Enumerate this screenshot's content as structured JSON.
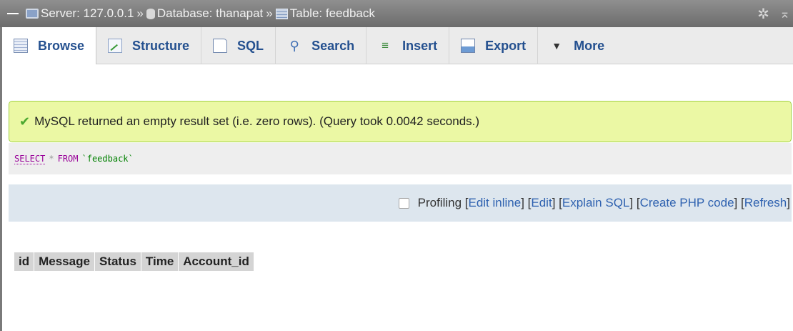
{
  "breadcrumb": {
    "server_label": "Server: 127.0.0.1",
    "separator": "»",
    "database_label": "Database: thanapat",
    "table_label": "Table: feedback"
  },
  "tabs": [
    {
      "label": "Browse",
      "icon": "browse-icon"
    },
    {
      "label": "Structure",
      "icon": "structure-icon"
    },
    {
      "label": "SQL",
      "icon": "sql-icon"
    },
    {
      "label": "Search",
      "icon": "search-icon"
    },
    {
      "label": "Insert",
      "icon": "insert-icon"
    },
    {
      "label": "Export",
      "icon": "export-icon"
    },
    {
      "label": "More",
      "icon": "triangle-down-icon"
    }
  ],
  "message": {
    "text": "MySQL returned an empty result set (i.e. zero rows). (Query took 0.0042 seconds.)",
    "icon": "check-icon",
    "color": "#ebf8a4"
  },
  "query": {
    "select": "SELECT",
    "star": "*",
    "from": "FROM",
    "table": "`feedback`"
  },
  "toolbar": {
    "profiling": "Profiling",
    "edit_inline": "Edit inline",
    "edit": " Edit ",
    "explain_sql": " Explain SQL ",
    "create_php": " Create PHP code ",
    "refresh": " Refresh"
  },
  "result_columns": [
    "id",
    "Message",
    "Status",
    "Time",
    "Account_id"
  ],
  "colors": {
    "tab_link": "#24508f",
    "link": "#2f62b0",
    "success_border": "#a2d246"
  }
}
